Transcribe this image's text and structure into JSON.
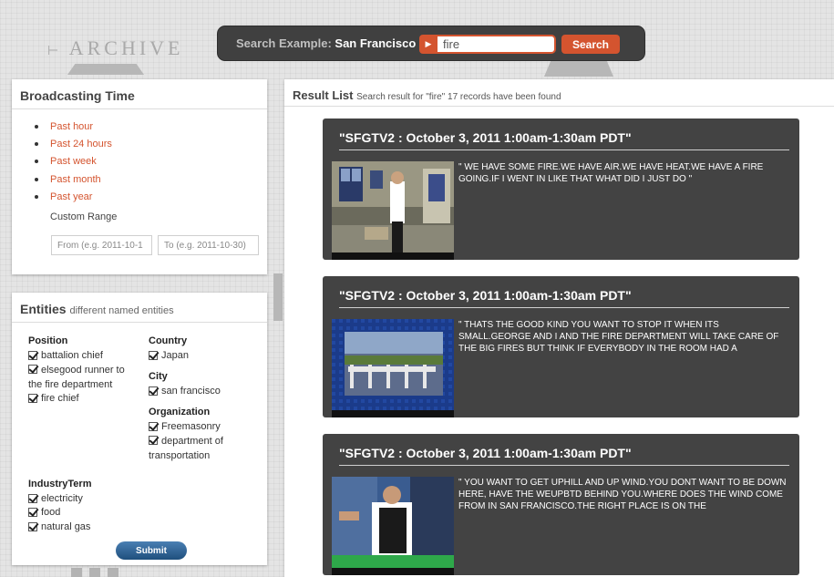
{
  "background": {
    "archive_text": "ARCHIVE"
  },
  "search": {
    "example_label": "Search Example:",
    "example_value": "San Francisco",
    "query": "fire",
    "button_label": "Search"
  },
  "broadcasting": {
    "title": "Broadcasting Time",
    "options": [
      "Past hour",
      "Past 24 hours",
      "Past week",
      "Past month",
      "Past year"
    ],
    "custom_range_label": "Custom Range",
    "from_placeholder": "From (e.g. 2011-10-1",
    "to_placeholder": "To (e.g. 2011-10-30)"
  },
  "entities": {
    "title": "Entities",
    "subtitle": "different named entities",
    "position": {
      "label": "Position",
      "items": [
        "battalion chief",
        "elsegood runner to the fire department",
        "fire chief"
      ]
    },
    "country": {
      "label": "Country",
      "items": [
        "Japan"
      ]
    },
    "city": {
      "label": "City",
      "items": [
        "san francisco"
      ]
    },
    "organization": {
      "label": "Organization",
      "items": [
        "Freemasonry",
        "department of transportation"
      ]
    },
    "industry": {
      "label": "IndustryTerm",
      "items": [
        "electricity",
        "food",
        "natural gas"
      ]
    },
    "submit_label": "Submit"
  },
  "results": {
    "title": "Result List",
    "summary": "Search result for \"fire\" 17 records have been found",
    "items": [
      {
        "title": "\"SFGTV2 : October 3, 2011 1:00am-1:30am PDT\"",
        "snippet": "\" WE HAVE SOME FIRE.WE HAVE AIR.WE HAVE HEAT.WE HAVE A FIRE GOING.IF I WENT IN LIKE THAT WHAT DID I JUST DO \""
      },
      {
        "title": "\"SFGTV2 : October 3, 2011 1:00am-1:30am PDT\"",
        "snippet": "\" THATS THE GOOD KIND YOU WANT TO STOP IT WHEN ITS SMALL.GEORGE AND I AND THE FIRE DEPARTMENT WILL TAKE CARE OF THE BIG FIRES BUT THINK IF EVERYBODY IN THE ROOM HAD A"
      },
      {
        "title": "\"SFGTV2 : October 3, 2011 1:00am-1:30am PDT\"",
        "snippet": "\" YOU WANT TO GET UPHILL AND UP WIND.YOU DONT WANT TO BE DOWN HERE, HAVE THE WEUPBTD BEHIND YOU.WHERE DOES THE WIND COME FROM IN SAN FRANCISCO.THE RIGHT PLACE IS ON THE"
      }
    ]
  },
  "colors": {
    "accent": "#d4542f",
    "card_bg": "#434343",
    "submit": "#1f4f7d"
  }
}
